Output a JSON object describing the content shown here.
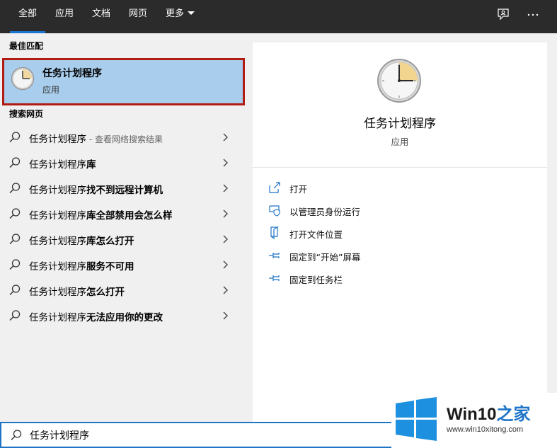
{
  "tabs": [
    {
      "label": "全部"
    },
    {
      "label": "应用"
    },
    {
      "label": "文档"
    },
    {
      "label": "网页"
    },
    {
      "label": "更多"
    }
  ],
  "left": {
    "best_match_title": "最佳匹配",
    "best_match": {
      "name": "任务计划程序",
      "type": "应用"
    },
    "web_title": "搜索网页",
    "suggestions": [
      {
        "base": "任务计划程序",
        "bold": "",
        "hint": " - 查看网络搜索结果"
      },
      {
        "base": "任务计划程序",
        "bold": "库",
        "hint": ""
      },
      {
        "base": "任务计划程序",
        "bold": "找不到远程计算机",
        "hint": ""
      },
      {
        "base": "任务计划程序",
        "bold": "库全部禁用会怎么样",
        "hint": ""
      },
      {
        "base": "任务计划程序",
        "bold": "库怎么打开",
        "hint": ""
      },
      {
        "base": "任务计划程序",
        "bold": "服务不可用",
        "hint": ""
      },
      {
        "base": "任务计划程序",
        "bold": "怎么打开",
        "hint": ""
      },
      {
        "base": "任务计划程序",
        "bold": "无法应用你的更改",
        "hint": ""
      }
    ]
  },
  "right": {
    "title": "任务计划程序",
    "subtitle": "应用",
    "actions": [
      {
        "label": "打开",
        "icon": "open-icon"
      },
      {
        "label": "以管理员身份运行",
        "icon": "shield-icon"
      },
      {
        "label": "打开文件位置",
        "icon": "file-location-icon"
      },
      {
        "label": "固定到“开始”屏幕",
        "icon": "pin-icon"
      },
      {
        "label": "固定到任务栏",
        "icon": "pin-icon"
      }
    ]
  },
  "search": {
    "value": "任务计划程序"
  },
  "watermark": {
    "brand": "Win10",
    "brand_accent": "之家",
    "url": "www.win10xitong.com"
  },
  "colors": {
    "topbar": "#2b2b2b",
    "tab_underline": "#1a75d0",
    "selected_bg": "#a9cdec",
    "selected_border": "#b11b12",
    "search_border": "#1f74c6"
  }
}
